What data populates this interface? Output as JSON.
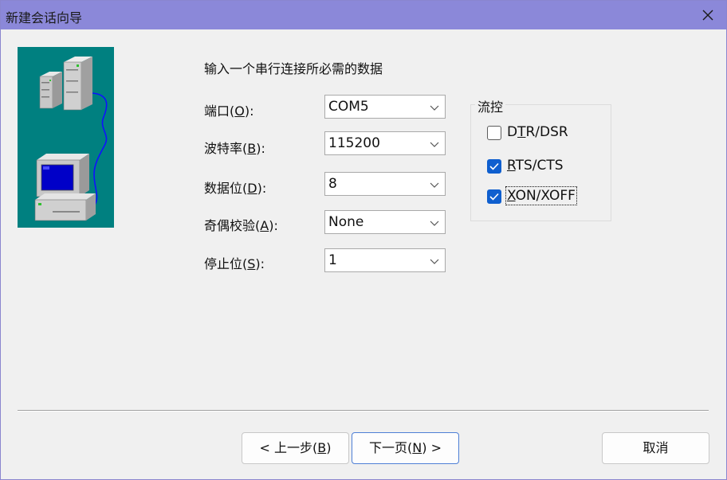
{
  "window": {
    "title": "新建会话向导",
    "accent_color": "#8b88d9"
  },
  "page": {
    "instruction": "输入一个串行连接所必需的数据"
  },
  "fields": [
    {
      "label": "端口",
      "mnemonic": "O",
      "value": "COM5"
    },
    {
      "label": "波特率",
      "mnemonic": "B",
      "value": "115200"
    },
    {
      "label": "数据位",
      "mnemonic": "D",
      "value": "8"
    },
    {
      "label": "奇偶校验",
      "mnemonic": "A",
      "value": "None"
    },
    {
      "label": "停止位",
      "mnemonic": "S",
      "value": "1"
    }
  ],
  "flow_control": {
    "title": "流控",
    "options": [
      {
        "label": "DTR/DSR",
        "checked": false,
        "mnemonic_index": 1
      },
      {
        "label": "RTS/CTS",
        "checked": true,
        "mnemonic_index": 0
      },
      {
        "label": "XON/XOFF",
        "checked": true,
        "mnemonic_index": 0,
        "focused": true
      }
    ]
  },
  "buttons": {
    "back": {
      "prefix": "< 上一步(",
      "mnemonic": "B",
      "suffix": ")"
    },
    "next": {
      "prefix": "下一页(",
      "mnemonic": "N",
      "suffix": ") >"
    },
    "cancel": {
      "label": "取消"
    }
  },
  "icons": {
    "close": "close-icon",
    "dropdown": "chevron-down-icon",
    "checkmark": "checkmark-icon",
    "wizard_art": "serial-connection-illustration"
  },
  "colors": {
    "image_bg": "#008080",
    "checkbox_checked": "#0f5fcf"
  }
}
